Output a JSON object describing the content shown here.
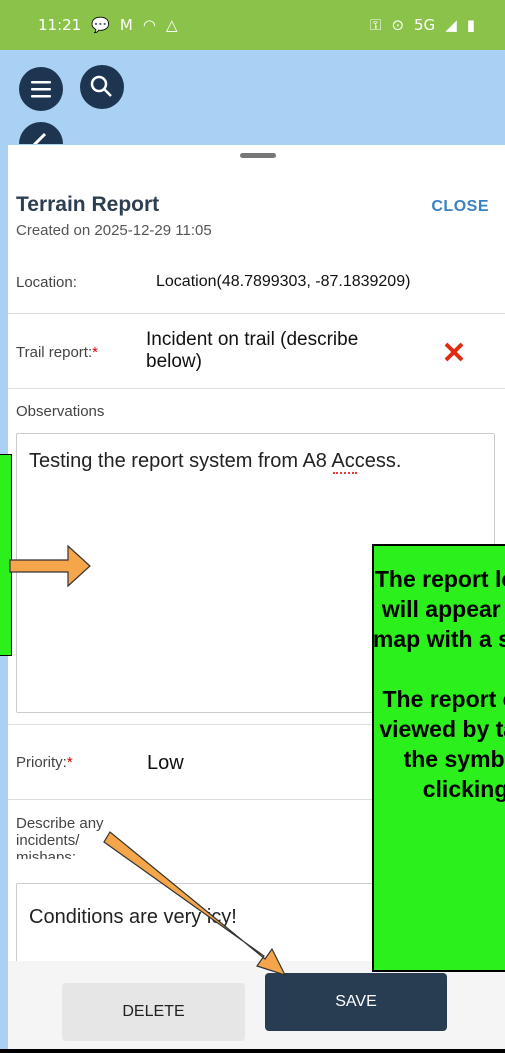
{
  "status_bar": {
    "time": "11:21",
    "network": "5G"
  },
  "map_controls": [
    "menu-icon",
    "search-icon",
    "back-icon"
  ],
  "sheet": {
    "title": "Terrain Report",
    "created": "Created on 2025-12-29 11:05",
    "close_label": "CLOSE",
    "location": {
      "label": "Location:",
      "value": "Location(48.7899303, -87.1839209)"
    },
    "trail_report": {
      "label": "Trail report:",
      "required": "*",
      "value_line1": "Incident on trail (describe",
      "value_line2": "below)"
    },
    "observations": {
      "label": "Observations",
      "value": "Testing the report system from A8 Access."
    },
    "priority": {
      "label": "Priority:",
      "required": "*",
      "value": "Low"
    },
    "incidents": {
      "label_line1": "Describe any",
      "label_line2": "incidents/",
      "label_line3": "mishaps:",
      "value": "Conditions are very icy!"
    },
    "delete_label": "DELETE",
    "save_label": "SAVE"
  },
  "callout": {
    "text": "The report location will appear on the map with a symbol.\n\nThe report can be viewed by tapping the symbol or clicking it."
  },
  "colors": {
    "status_green": "#8bc34a",
    "map_blue": "#a8d1f3",
    "navy": "#283d52",
    "callout_green": "#2cf01c",
    "arrow_orange": "#f5a54a",
    "link_blue": "#3b82c4"
  }
}
